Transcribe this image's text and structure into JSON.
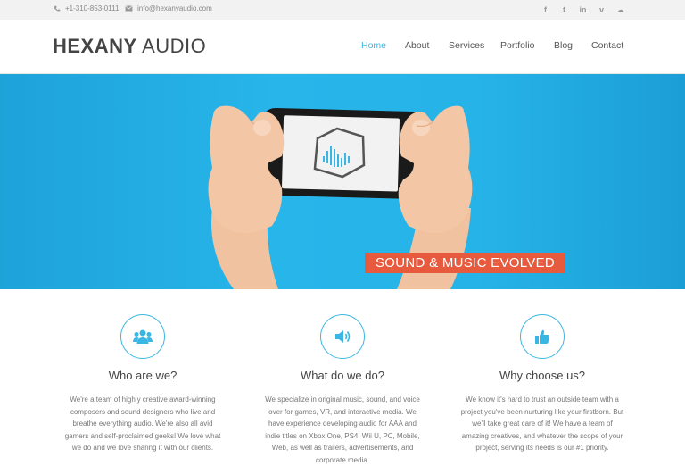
{
  "topbar": {
    "phone": "+1-310-853-0111",
    "email": "info@hexanyaudio.com",
    "social": [
      {
        "icon": "facebook-icon",
        "glyph": "f"
      },
      {
        "icon": "twitter-icon",
        "glyph": "t"
      },
      {
        "icon": "linkedin-icon",
        "glyph": "in"
      },
      {
        "icon": "vimeo-icon",
        "glyph": "v"
      },
      {
        "icon": "soundcloud-icon",
        "glyph": "☁"
      }
    ]
  },
  "header": {
    "logo_bold": "HEXANY",
    "logo_light": "AUDIO",
    "nav": [
      {
        "label": "Home",
        "active": true
      },
      {
        "label": "About"
      },
      {
        "label": "Services"
      },
      {
        "label": "Portfolio"
      },
      {
        "label": "Blog"
      },
      {
        "label": "Contact"
      }
    ]
  },
  "hero": {
    "tagline": "SOUND & MUSIC EVOLVED",
    "colors": {
      "background": "#26b3e8",
      "tagline_bg": "#e85a3e"
    }
  },
  "features": [
    {
      "icon": "users-icon",
      "title": "Who are we?",
      "text": "We're a team of highly creative award-winning composers and sound designers who live and breathe everything audio. We're also all avid gamers and self-proclaimed geeks! We love what we do and we love sharing it with our clients."
    },
    {
      "icon": "volume-icon",
      "title": "What do we do?",
      "text": "We specialize in original music, sound, and voice over for games, VR, and interactive media. We have experience developing audio for AAA and indie titles on Xbox One, PS4, Wii U, PC, Mobile, Web, as well as trailers, advertisements, and corporate media."
    },
    {
      "icon": "thumbs-up-icon",
      "title": "Why choose us?",
      "text": "We know it's hard to trust an outside team with a project you've been nurturing like your firstborn. But we'll take great care of it! We have a team of amazing creatives, and whatever the scope of your project, serving its needs is our #1 priority."
    }
  ],
  "accent_color": "#3ab6e4"
}
